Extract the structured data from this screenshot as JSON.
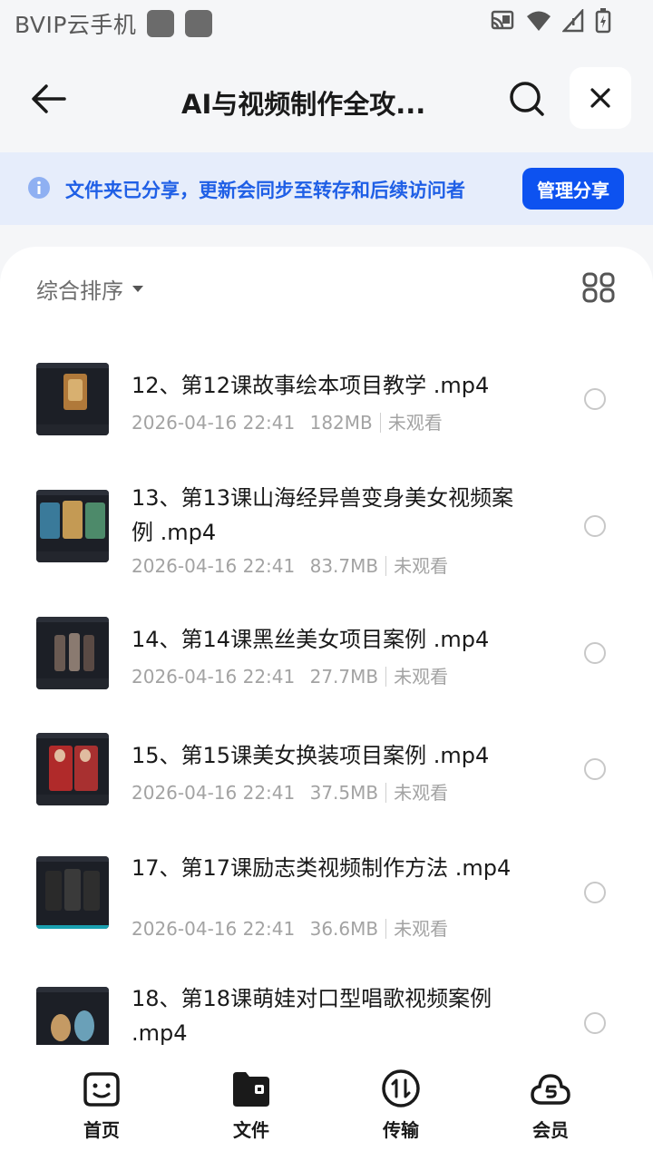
{
  "status_bar": {
    "title": "BVIP云手机"
  },
  "header": {
    "title": "AI与视频制作全攻..."
  },
  "banner": {
    "text": "文件夹已分享，更新会同步至转存和后续访问者",
    "button_label": "管理分享"
  },
  "toolbar": {
    "sort_label": "综合排序"
  },
  "files": [
    {
      "name": "12、第12课故事绘本项目教学 .mp4",
      "date": "2026-04-16 22:41",
      "size": "182MB",
      "status": "未观看"
    },
    {
      "name": "13、第13课山海经异兽变身美女视频案例 .mp4",
      "date": "2026-04-16 22:41",
      "size": "83.7MB",
      "status": "未观看"
    },
    {
      "name": "14、第14课黑丝美女项目案例 .mp4",
      "date": "2026-04-16 22:41",
      "size": "27.7MB",
      "status": "未观看"
    },
    {
      "name": "15、第15课美女换装项目案例 .mp4",
      "date": "2026-04-16 22:41",
      "size": "37.5MB",
      "status": "未观看"
    },
    {
      "name": "17、第17课励志类视频制作方法 .mp4",
      "date": "2026-04-16 22:41",
      "size": "36.6MB",
      "status": "未观看"
    },
    {
      "name": "18、第18课萌娃对口型唱歌视频案例 .mp4",
      "date": "",
      "size": "",
      "status": ""
    }
  ],
  "nav": {
    "home": "首页",
    "files": "文件",
    "transfer": "传输",
    "vip": "会员"
  },
  "colors": {
    "accent": "#0d52f0",
    "banner_bg": "#e6edfb",
    "banner_text": "#1f5fe6"
  }
}
